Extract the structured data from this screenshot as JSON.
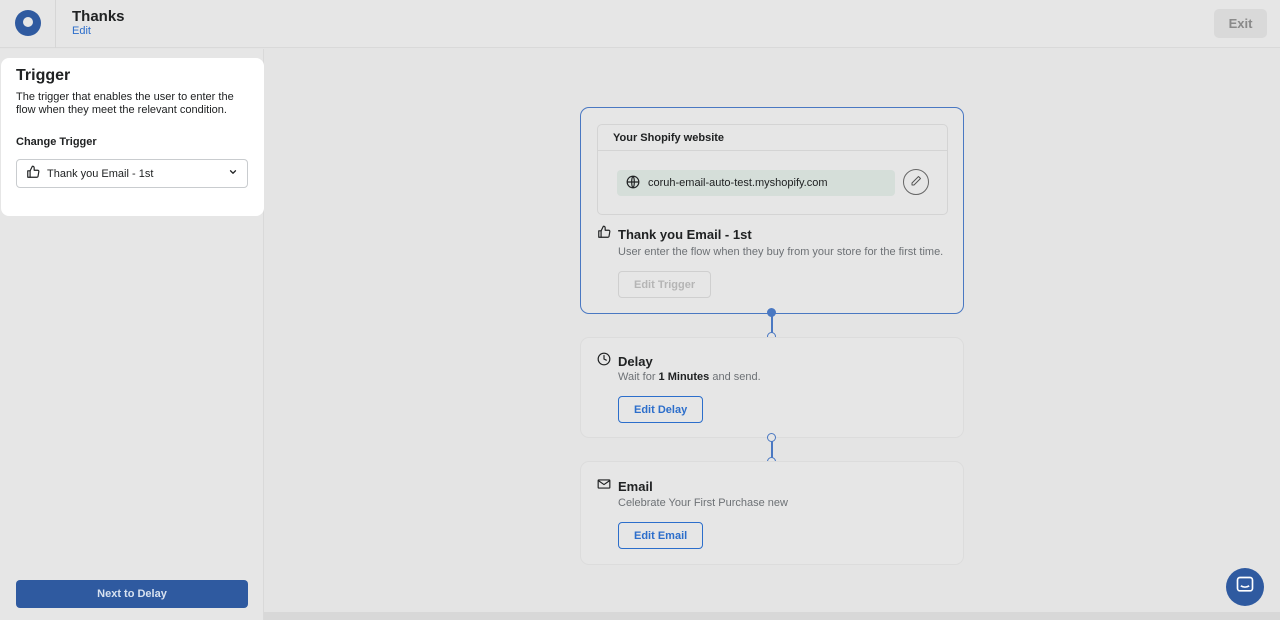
{
  "header": {
    "flow_title": "Thanks",
    "edit_label": "Edit",
    "exit_label": "Exit"
  },
  "panel": {
    "title": "Trigger",
    "description": "The trigger that enables the user to enter the flow when they meet the relevant condition.",
    "change_label": "Change Trigger",
    "selected_trigger": "Thank you Email - 1st",
    "next_button": "Next to Delay"
  },
  "flow": {
    "trigger": {
      "shop_header": "Your Shopify website",
      "shop_url": "coruh-email-auto-test.myshopify.com",
      "title": "Thank you Email - 1st",
      "description": "User enter the flow when they buy from your store for the first time.",
      "button": "Edit Trigger"
    },
    "delay": {
      "title": "Delay",
      "desc_prefix": "Wait for ",
      "desc_value": "1 Minutes",
      "desc_suffix": " and send.",
      "button": "Edit Delay"
    },
    "email": {
      "title": "Email",
      "description": "Celebrate Your First Purchase new",
      "button": "Edit Email"
    }
  },
  "icons": {
    "logo": "app-logo",
    "thumb": "thumbs-up-icon",
    "chevron": "chevron-down-icon",
    "globe": "globe-icon",
    "pencil": "pencil-icon",
    "clock": "clock-icon",
    "mail": "mail-icon",
    "chat": "chat-icon"
  },
  "colors": {
    "primary": "#2f5aa0",
    "link": "#2c6ecb",
    "background": "#e6e6e6",
    "panel": "#ffffff"
  }
}
